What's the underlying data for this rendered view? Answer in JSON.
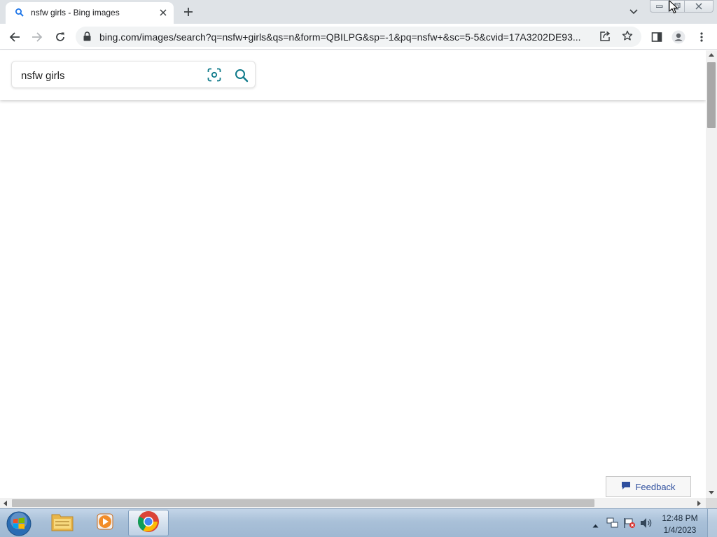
{
  "browser": {
    "tab": {
      "title": "nsfw girls - Bing images",
      "favicon": "search-icon"
    },
    "url": "bing.com/images/search?q=nsfw+girls&qs=n&form=QBILPG&sp=-1&pq=nsfw+&sc=5-5&cvid=17A3202DE93...",
    "toolbar_icons": [
      "back-icon",
      "forward-icon",
      "reload-icon",
      "lock-icon",
      "share-icon",
      "star-icon",
      "sidebar-icon",
      "profile-icon",
      "menu-icon"
    ]
  },
  "page": {
    "search": {
      "value": "nsfw girls"
    },
    "feedback_label": "Feedback"
  },
  "taskbar": {
    "items": [
      "start-orb",
      "windows-explorer",
      "windows-media-player",
      "google-chrome"
    ],
    "clock": {
      "time": "12:48 PM",
      "date": "1/4/2023"
    }
  },
  "colors": {
    "tabstrip": "#dfe3e7",
    "bing_teal": "#0f7a8a",
    "feedback_text": "#2f4f9e",
    "taskbar": "#a9c0d8"
  }
}
